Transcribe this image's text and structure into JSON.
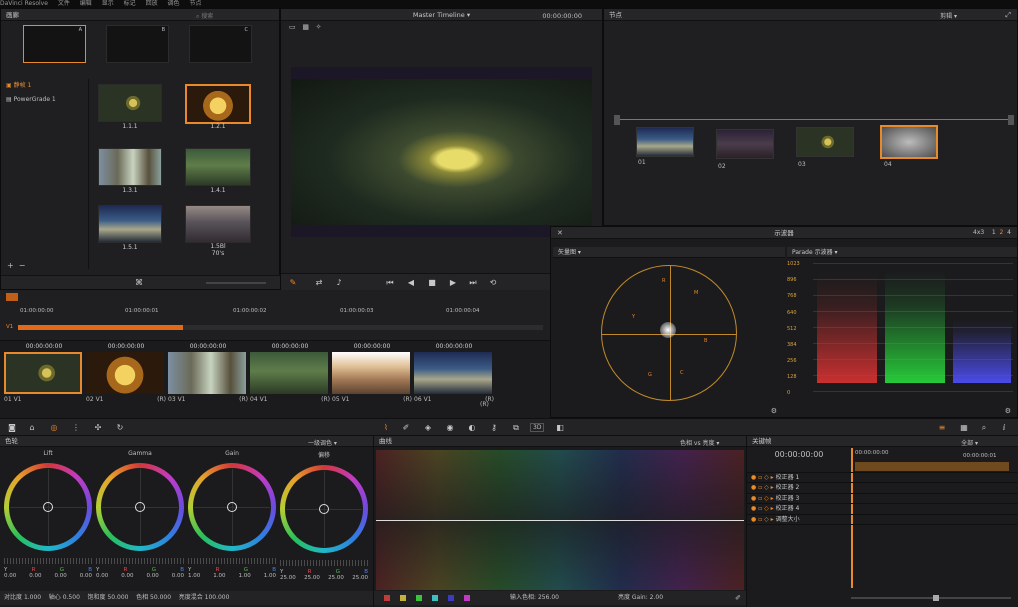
{
  "menubar": {
    "items": [
      "DaVinci Resolve",
      "文件",
      "编辑",
      "显示",
      "标记",
      "回放",
      "调色",
      "节点"
    ]
  },
  "gallery": {
    "title": "画廊",
    "search_placeholder": "搜索",
    "stills_letters": [
      "A",
      "B",
      "C"
    ],
    "albums": [
      {
        "label": "静帧 1"
      },
      {
        "label": "PowerGrade 1"
      }
    ],
    "stills": [
      {
        "label": "1.1.1"
      },
      {
        "label": "1.2.1"
      },
      {
        "label": "1.3.1"
      },
      {
        "label": "1.4.1"
      },
      {
        "label": "1.5.1"
      },
      {
        "label": "1.5Bl",
        "sub": "70's"
      }
    ]
  },
  "viewer": {
    "title": "Master Timeline",
    "timecode": "00:00:00:00"
  },
  "nodes": {
    "title": "节点",
    "mode": "剪辑",
    "items": [
      {
        "label": "01"
      },
      {
        "label": "02"
      },
      {
        "label": "03"
      },
      {
        "label": "04"
      }
    ]
  },
  "scopes": {
    "title": "示波器",
    "layout": "4x3",
    "pages": [
      "1",
      "2",
      "4"
    ],
    "vectorscope": {
      "label": "矢量图",
      "targets": [
        "R",
        "M",
        "B",
        "C",
        "G",
        "Y"
      ]
    },
    "parade": {
      "label": "Parade 示波器",
      "ticks": [
        "1023",
        "896",
        "768",
        "640",
        "512",
        "384",
        "256",
        "128",
        "0"
      ]
    }
  },
  "timeline": {
    "timecodes": [
      "01:00:00:00",
      "01:00:00:01",
      "01:00:00:02",
      "01:00:00:03",
      "01:00:00:04"
    ],
    "v_track": "V1",
    "clips": [
      {
        "tc": "00:00:00:00",
        "num": "01",
        "track": "V1",
        "tag": "(R)"
      },
      {
        "tc": "00:00:00:00",
        "num": "02",
        "track": "V1",
        "tag": "(R)"
      },
      {
        "tc": "00:00:00:00",
        "num": "03",
        "track": "V1",
        "tag": "(R)"
      },
      {
        "tc": "00:00:00:00",
        "num": "04",
        "track": "V1",
        "tag": "(R)"
      },
      {
        "tc": "00:00:00:00",
        "num": "05",
        "track": "V1",
        "tag": "(R)"
      },
      {
        "tc": "00:00:00:00",
        "num": "06",
        "track": "V1",
        "tag": "(R)"
      }
    ]
  },
  "color_wheels": {
    "title": "色轮",
    "mode": "一级调色",
    "wheels": [
      {
        "name": "Lift",
        "vals": [
          "0.00",
          "0.00",
          "0.00",
          "0.00"
        ]
      },
      {
        "name": "Gamma",
        "vals": [
          "0.00",
          "0.00",
          "0.00",
          "0.00"
        ]
      },
      {
        "name": "Gain",
        "vals": [
          "1.00",
          "1.00",
          "1.00",
          "1.00"
        ]
      },
      {
        "name": "偏移",
        "vals": [
          "25.00",
          "25.00",
          "25.00",
          "25.00"
        ]
      }
    ],
    "channels": [
      "Y",
      "R",
      "G",
      "B"
    ],
    "footer": {
      "contrast_label": "对比度",
      "contrast": "1.000",
      "pivot_label": "轴心",
      "pivot": "0.500",
      "sat_label": "饱和度",
      "sat": "50.000",
      "hue_label": "色相",
      "hue": "50.000",
      "lum_label": "亮度混合",
      "lum": "100.000"
    }
  },
  "curves": {
    "title": "曲线",
    "mode": "色相 vs 亮度",
    "input_label": "输入色相:",
    "input": "256.00",
    "gain_label": "亮度 Gain:",
    "gain": "2.00"
  },
  "keyframes": {
    "title": "关键帧",
    "mode": "全部",
    "timecode": "00:00:00:00",
    "tc1": "00:00:00:00",
    "tc2": "00:00:00:01",
    "rows": [
      "主控",
      "校正器 1",
      "校正器 2",
      "校正器 3",
      "校正器 4",
      "调整大小"
    ]
  }
}
